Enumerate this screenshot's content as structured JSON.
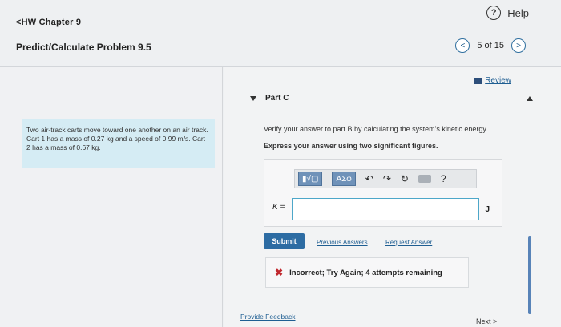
{
  "header": {
    "help_icon": "?",
    "help_label": "Help",
    "back_label": "<HW Chapter 9",
    "problem_title": "Predict/Calculate Problem 9.5",
    "prev_icon": "<",
    "pager_text": "5 of 15",
    "next_icon": ">"
  },
  "problem": {
    "text": "Two air-track carts move toward one another on an air track. Cart 1 has a mass of 0.27 kg and a speed of 0.99 m/s. Cart 2 has a mass of 0.67 kg."
  },
  "part": {
    "review_label": "Review",
    "title": "Part C",
    "question": "Verify your answer to part B by calculating the system's kinetic energy.",
    "instruction": "Express your answer using two significant figures.",
    "variable_label": "K =",
    "input_value": "",
    "units": "J"
  },
  "toolbar": {
    "template_label": "▮√▢",
    "symbols_label": "ΑΣφ",
    "undo_icon": "↶",
    "redo_icon": "↷",
    "reset_icon": "↻",
    "keyboard_icon": "keyboard-icon",
    "help_icon": "?"
  },
  "actions": {
    "submit_label": "Submit",
    "previous_answers_label": "Previous Answers",
    "request_answer_label": "Request Answer",
    "feedback_icon": "✖",
    "feedback_text": "Incorrect; Try Again; 4 attempts remaining",
    "provide_feedback_label": "Provide Feedback",
    "next_label": "Next >"
  },
  "colors": {
    "primary_blue": "#2d6ca3",
    "link_blue": "#1f5e92",
    "problem_box": "#d5ecf4",
    "incorrect_red": "#c0272d"
  }
}
